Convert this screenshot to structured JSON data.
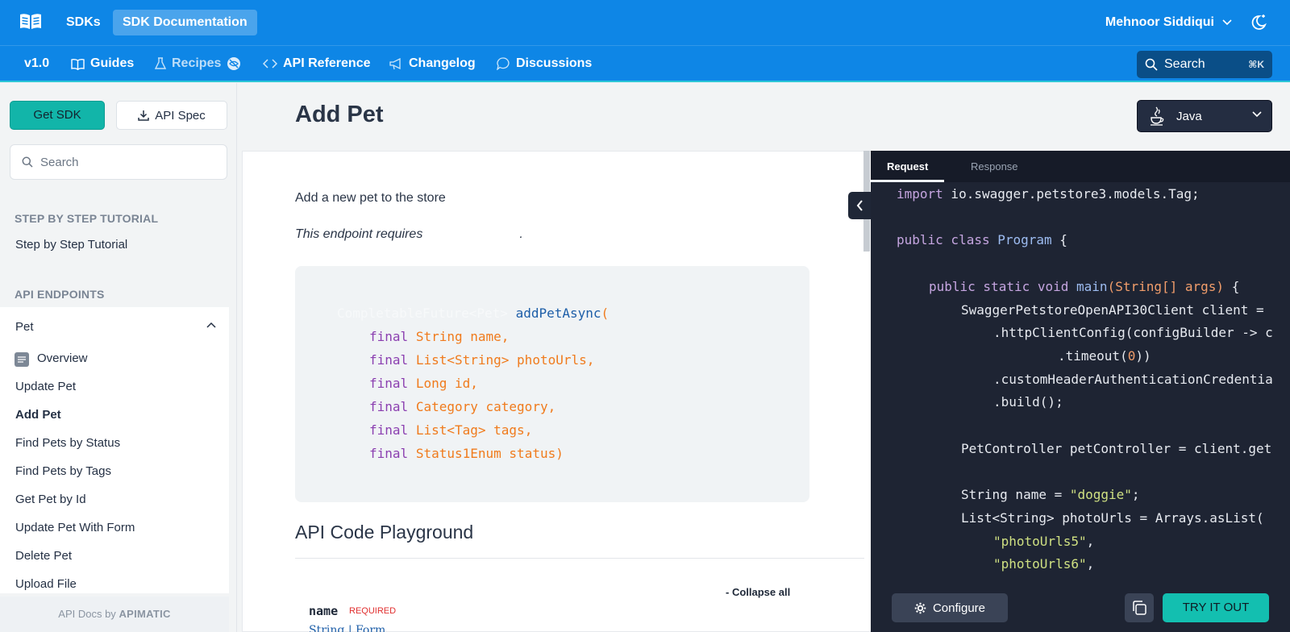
{
  "topbar": {
    "sdks_label": "SDKs",
    "docs_label": "SDK Documentation",
    "user_name": "Mehnoor Siddiqui"
  },
  "nav": {
    "version": "v1.0",
    "items": [
      {
        "label": "Guides",
        "icon": "book-icon"
      },
      {
        "label": "Recipes",
        "icon": "flask-icon"
      },
      {
        "label": "API Reference",
        "icon": "code-icon"
      },
      {
        "label": "Changelog",
        "icon": "megaphone-icon"
      },
      {
        "label": "Discussions",
        "icon": "chat-bubble-icon"
      }
    ],
    "search_label": "Search",
    "search_shortcut": "⌘K"
  },
  "sidebar": {
    "get_sdk_label": "Get SDK",
    "api_spec_label": "API Spec",
    "search_placeholder": "Search",
    "section_tutorial": "STEP BY STEP TUTORIAL",
    "tutorial_link": "Step by Step Tutorial",
    "section_endpoints": "API ENDPOINTS",
    "group": "Pet",
    "items": [
      "Overview",
      "Update Pet",
      "Add Pet",
      "Find Pets by Status",
      "Find Pets by Tags",
      "Get Pet by Id",
      "Update Pet With Form",
      "Delete Pet",
      "Upload File"
    ],
    "active_item": "Add Pet",
    "footer_prefix": "API Docs by",
    "footer_brand": "APIMATIC"
  },
  "main": {
    "title": "Add Pet",
    "language": "Java",
    "description": "Add a new pet to the store",
    "requires_text": "This endpoint requires",
    "requires_suffix": ".",
    "signature": {
      "return_type": "CompletableFuture<Pet>",
      "method": "addPetAsync",
      "params": [
        {
          "type": "String",
          "name": "name"
        },
        {
          "type": "List<String>",
          "name": "photoUrls"
        },
        {
          "type": "Long",
          "name": "id"
        },
        {
          "type": "Category",
          "name": "category"
        },
        {
          "type": "List<Tag>",
          "name": "tags"
        },
        {
          "type": "Status1Enum",
          "name": "status"
        }
      ]
    },
    "playground_heading": "API Code Playground",
    "collapse_all": "- Collapse all",
    "param_name": "name",
    "param_required": "REQUIRED",
    "param_type": "String | Form"
  },
  "code_panel": {
    "tabs": [
      "Request",
      "Response"
    ],
    "active_tab": "Request",
    "configure_label": "Configure",
    "try_label": "TRY IT OUT"
  }
}
